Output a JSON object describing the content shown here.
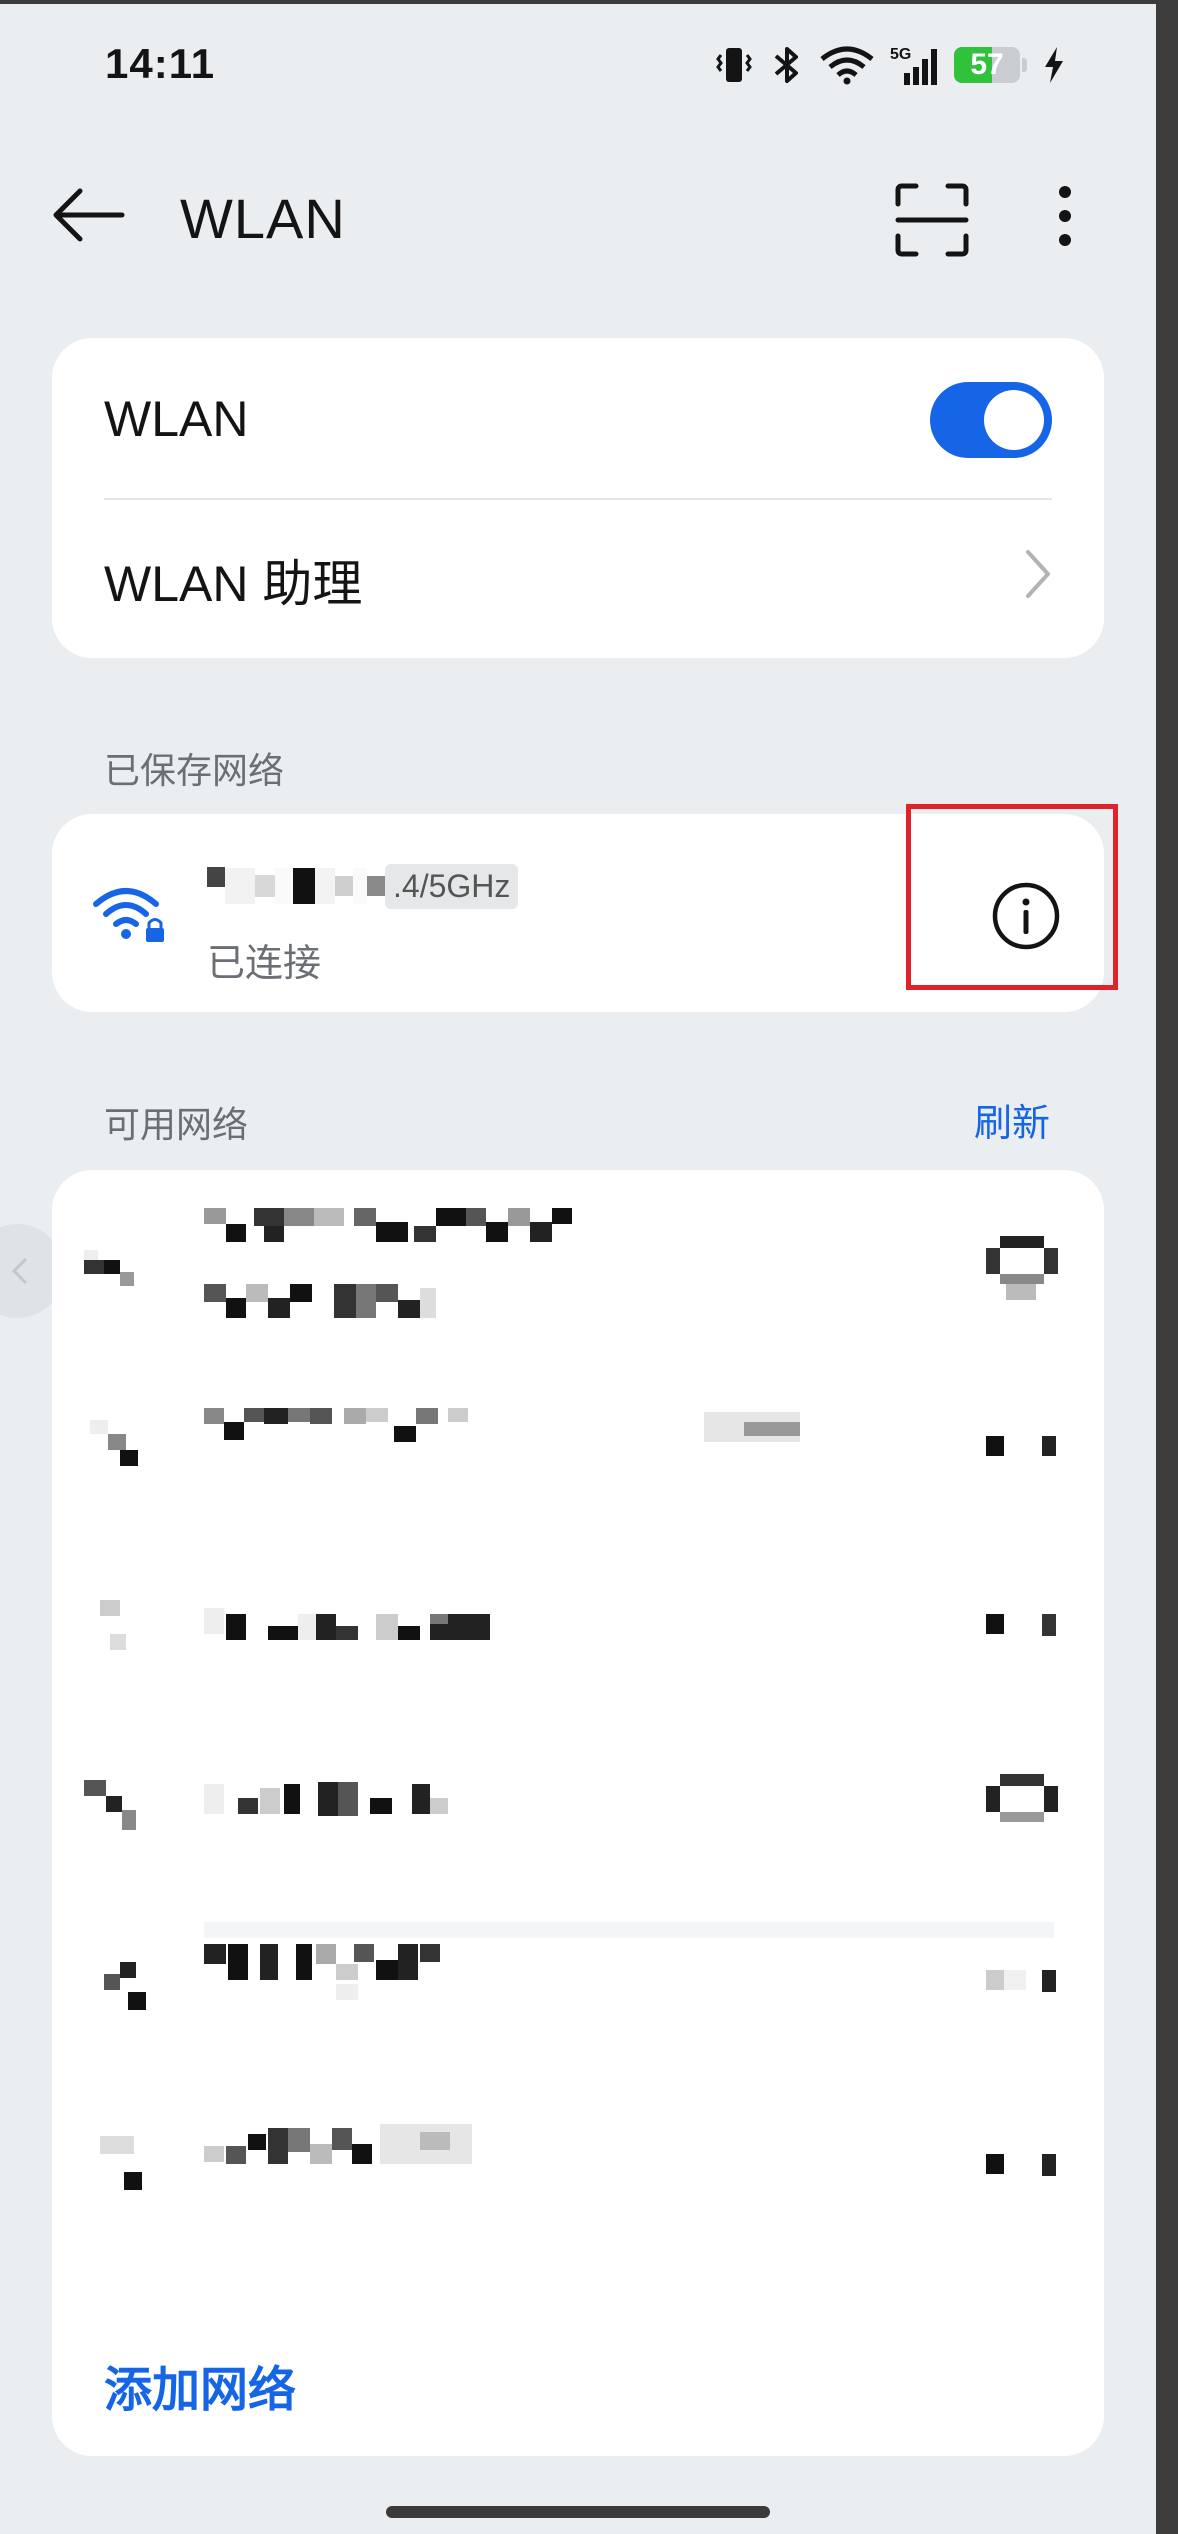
{
  "status_bar": {
    "time": "14:11",
    "network_type": "5G",
    "battery_level": "57",
    "battery_percent": 57,
    "icons": [
      "vibrate-icon",
      "bluetooth-icon",
      "wifi-icon",
      "cellular-signal-icon",
      "battery-icon",
      "charging-icon"
    ]
  },
  "header": {
    "title": "WLAN",
    "icons": [
      "back-arrow-icon",
      "scan-icon",
      "more-vertical-icon"
    ]
  },
  "settings_card": {
    "wlan_label": "WLAN",
    "wlan_enabled": true,
    "assistant_label": "WLAN 助理"
  },
  "saved_networks": {
    "section_title": "已保存网络",
    "network": {
      "ssid_visible_suffix": ".4/5GHz",
      "status": "已连接",
      "icons": [
        "wifi-locked-icon",
        "info-icon"
      ]
    }
  },
  "available_networks": {
    "section_title": "可用网络",
    "refresh_label": "刷新",
    "add_network_label": "添加网络"
  },
  "colors": {
    "accent": "#1565e6",
    "background": "#ebeef1",
    "card": "#ffffff",
    "highlight_box": "#e0232b",
    "battery_fill": "#2fc23a"
  }
}
